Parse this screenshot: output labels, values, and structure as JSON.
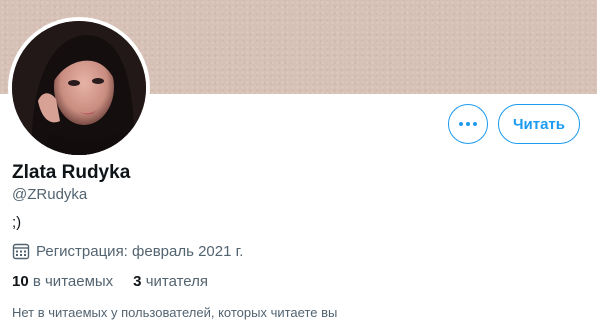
{
  "profile": {
    "name": "Zlata Rudyka",
    "handle": "@ZRudyka",
    "bio": ";)",
    "joined": "Регистрация: февраль 2021 г.",
    "following_count": "10",
    "following_label": "в читаемых",
    "followers_count": "3",
    "followers_label": "читателя",
    "followers_you_know": "Нет в читаемых у пользователей, которых читаете вы"
  },
  "actions": {
    "more_icon": "more-horizontal-icon",
    "follow_label": "Читать"
  },
  "colors": {
    "accent": "#1d9bf0",
    "banner": "#d7c1b6",
    "secondary_text": "#536471",
    "primary_text": "#0f1419"
  }
}
